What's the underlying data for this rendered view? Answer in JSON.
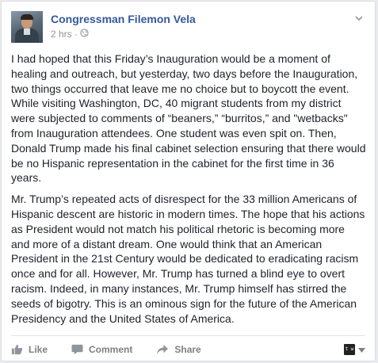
{
  "post": {
    "author": "Congressman Filemon Vela",
    "timestamp": "2 hrs",
    "separator": "·",
    "audience_icon": "globe-icon",
    "menu_icon": "chevron-down-icon",
    "paragraphs": [
      "I had hoped that this Friday’s Inauguration would be a moment of healing and outreach, but yesterday, two days before the Inauguration, two things occurred that leave me no choice but to boycott the event. While visiting Washington, DC, 40 migrant students from my district were subjected to comments of “beaners,” “burritos,” and \"wetbacks\" from Inauguration attendees. One student was even spit on. Then, Donald Trump made his final cabinet selection ensuring that there would be no Hispanic representation in the cabinet for the first time in 36 years.",
      "Mr. Trump’s repeated acts of disrespect for the 33 million Americans of Hispanic descent are historic in modern times. The hope that his actions as President would not match his political rhetoric is becoming more and more of a distant dream. One would think that an American President in the 21st Century would be dedicated to eradicating racism once and for all. However, Mr. Trump has turned a blind eye to overt racism. Indeed, in many instances, Mr. Trump himself has stirred the seeds of bigotry. This is an ominous sign for the future of the American Presidency and the United States of America."
    ]
  },
  "actions": {
    "like": "Like",
    "comment": "Comment",
    "share": "Share",
    "share_as_avatar_text": "t w"
  },
  "colors": {
    "link": "#365899",
    "text": "#1d2129",
    "meta": "#90949c",
    "action": "#7f7f7f"
  }
}
